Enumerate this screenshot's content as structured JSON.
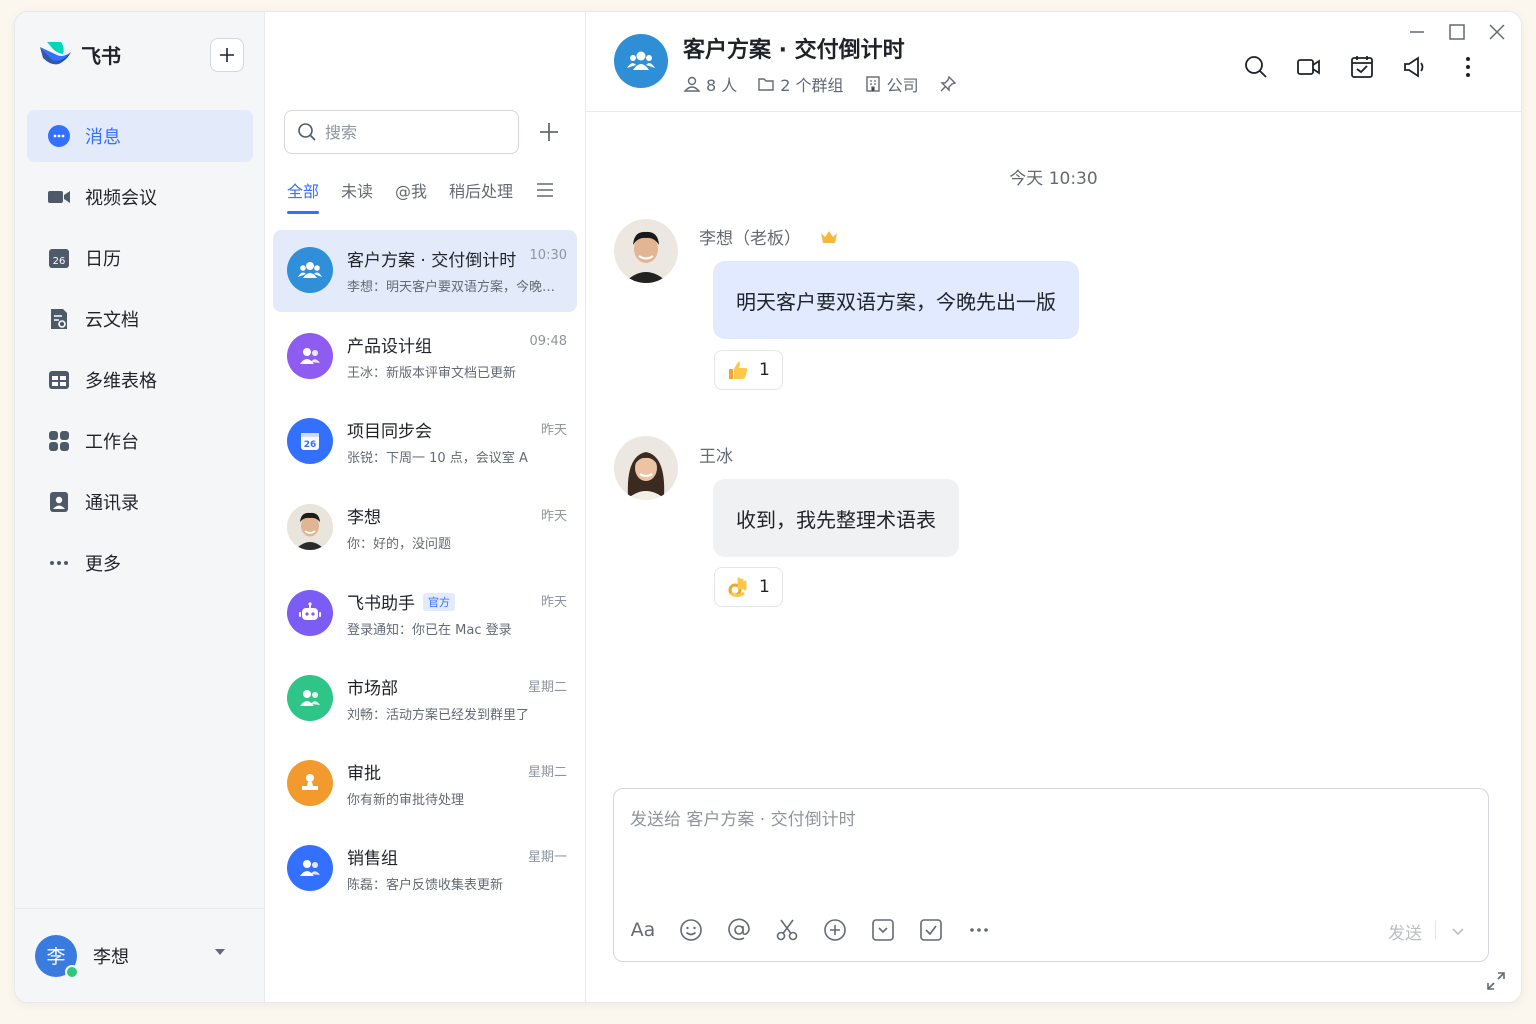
{
  "app": {
    "name": "飞书"
  },
  "nav": {
    "items": [
      {
        "label": "消息",
        "icon": "message-icon",
        "active": true
      },
      {
        "label": "视频会议",
        "icon": "video-icon"
      },
      {
        "label": "日历",
        "icon": "calendar-icon",
        "badge": "26"
      },
      {
        "label": "云文档",
        "icon": "docs-icon"
      },
      {
        "label": "多维表格",
        "icon": "base-icon"
      },
      {
        "label": "工作台",
        "icon": "workplace-icon"
      },
      {
        "label": "通讯录",
        "icon": "contacts-icon"
      },
      {
        "label": "更多",
        "icon": "more-icon"
      }
    ],
    "user": {
      "avatar_text": "李",
      "name": "李想"
    }
  },
  "list": {
    "search_placeholder": "搜索",
    "tabs": [
      "全部",
      "未读",
      "@我",
      "稍后处理"
    ],
    "conversations": [
      {
        "title": "客户方案 · 交付倒计时",
        "time": "10:30",
        "preview": "李想：明天客户要双语方案，今晚先出一版",
        "avatar_color": "#2f8fd8",
        "icon": "group-icon",
        "active": true
      },
      {
        "title": "产品设计组",
        "time": "09:48",
        "preview": "王冰：新版本评审文档已更新",
        "avatar_color": "#8e5cf0",
        "icon": "group-icon"
      },
      {
        "title": "项目同步会",
        "time": "昨天",
        "preview": "张锐：下周一 10 点，会议室 A",
        "avatar_color": "#3370ff",
        "icon": "calendar-icon",
        "badge": "26"
      },
      {
        "title": "李想",
        "time": "昨天",
        "preview": "你：好的，没问题",
        "avatar_color": "#e9e4dc",
        "icon": "person-photo-icon"
      },
      {
        "title": "飞书助手",
        "tag": "官方",
        "time": "昨天",
        "preview": "登录通知：你已在 Mac 登录",
        "avatar_color": "#7b5cf5",
        "icon": "robot-icon"
      },
      {
        "title": "市场部",
        "time": "星期二",
        "preview": "刘畅：活动方案已经发到群里了",
        "avatar_color": "#2fc488",
        "icon": "group-icon"
      },
      {
        "title": "审批",
        "time": "星期二",
        "preview": "你有新的审批待处理",
        "avatar_color": "#f29a2e",
        "icon": "approval-icon"
      },
      {
        "title": "销售组",
        "time": "星期一",
        "preview": "陈磊：客户反馈收集表更新",
        "avatar_color": "#3370ff",
        "icon": "group-icon"
      }
    ]
  },
  "chat": {
    "title": "客户方案 · 交付倒计时",
    "meta": [
      {
        "icon": "member-icon",
        "text": "8 人"
      },
      {
        "icon": "folder-icon",
        "text": "2 个群组"
      },
      {
        "icon": "company-icon",
        "text": "公司"
      }
    ],
    "time_divider": "今天 10:30",
    "messages": [
      {
        "sender": "李想（老板）",
        "text": "明天客户要双语方案，今晚先出一版",
        "reaction": {
          "icon": "thumbs-up-icon",
          "count": "1"
        }
      },
      {
        "sender": "王冰",
        "text": "收到，我先整理术语表",
        "reaction": {
          "icon": "ok-hand-icon",
          "count": "1"
        }
      }
    ],
    "composer": {
      "placeholder": "发送给 客户方案 · 交付倒计时",
      "font_tool": "Aa",
      "send_label": "发送"
    }
  },
  "colors": {
    "accent": "#3370ff",
    "active_bg": "#e3ebfa",
    "bubble_blue": "#e1eaff",
    "bubble_gray": "#f0f1f3"
  }
}
